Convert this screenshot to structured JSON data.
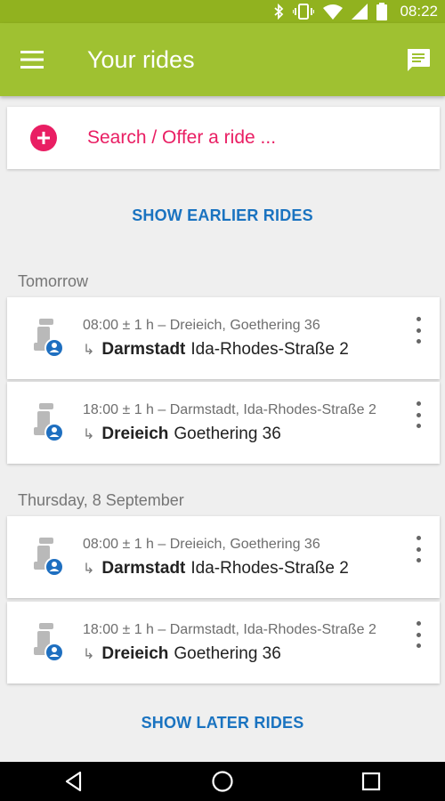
{
  "status_bar": {
    "time": "08:22",
    "icons": [
      "bluetooth-icon",
      "vibrate-icon",
      "wifi-icon",
      "signal-icon",
      "battery-icon"
    ]
  },
  "app_bar": {
    "title": "Your rides",
    "menu_icon": "hamburger-menu-icon",
    "action_icon": "chat-icon",
    "color": "#9fc131"
  },
  "search": {
    "placeholder": "Search / Offer a ride ...",
    "icon": "plus-circle-icon",
    "accent_color": "#e91e63"
  },
  "show_earlier": "SHOW EARLIER RIDES",
  "show_later": "SHOW LATER RIDES",
  "sections": [
    {
      "title": "Tomorrow",
      "rides": [
        {
          "departure": "08:00 ± 1 h – Dreieich, Goethering 36",
          "dest_city": "Darmstadt",
          "dest_street": "Ida-Rhodes-Straße 2"
        },
        {
          "departure": "18:00 ± 1 h – Darmstadt, Ida-Rhodes-Straße 2",
          "dest_city": "Dreieich",
          "dest_street": "Goethering 36"
        }
      ]
    },
    {
      "title": "Thursday, 8 September",
      "rides": [
        {
          "departure": "08:00 ± 1 h – Dreieich, Goethering 36",
          "dest_city": "Darmstadt",
          "dest_street": "Ida-Rhodes-Straße 2"
        },
        {
          "departure": "18:00 ± 1 h – Darmstadt, Ida-Rhodes-Straße 2",
          "dest_city": "Dreieich",
          "dest_street": "Goethering 36"
        }
      ]
    }
  ],
  "link_color": "#1a73c0",
  "nav_bar": [
    "back-icon",
    "home-icon",
    "recents-icon"
  ]
}
